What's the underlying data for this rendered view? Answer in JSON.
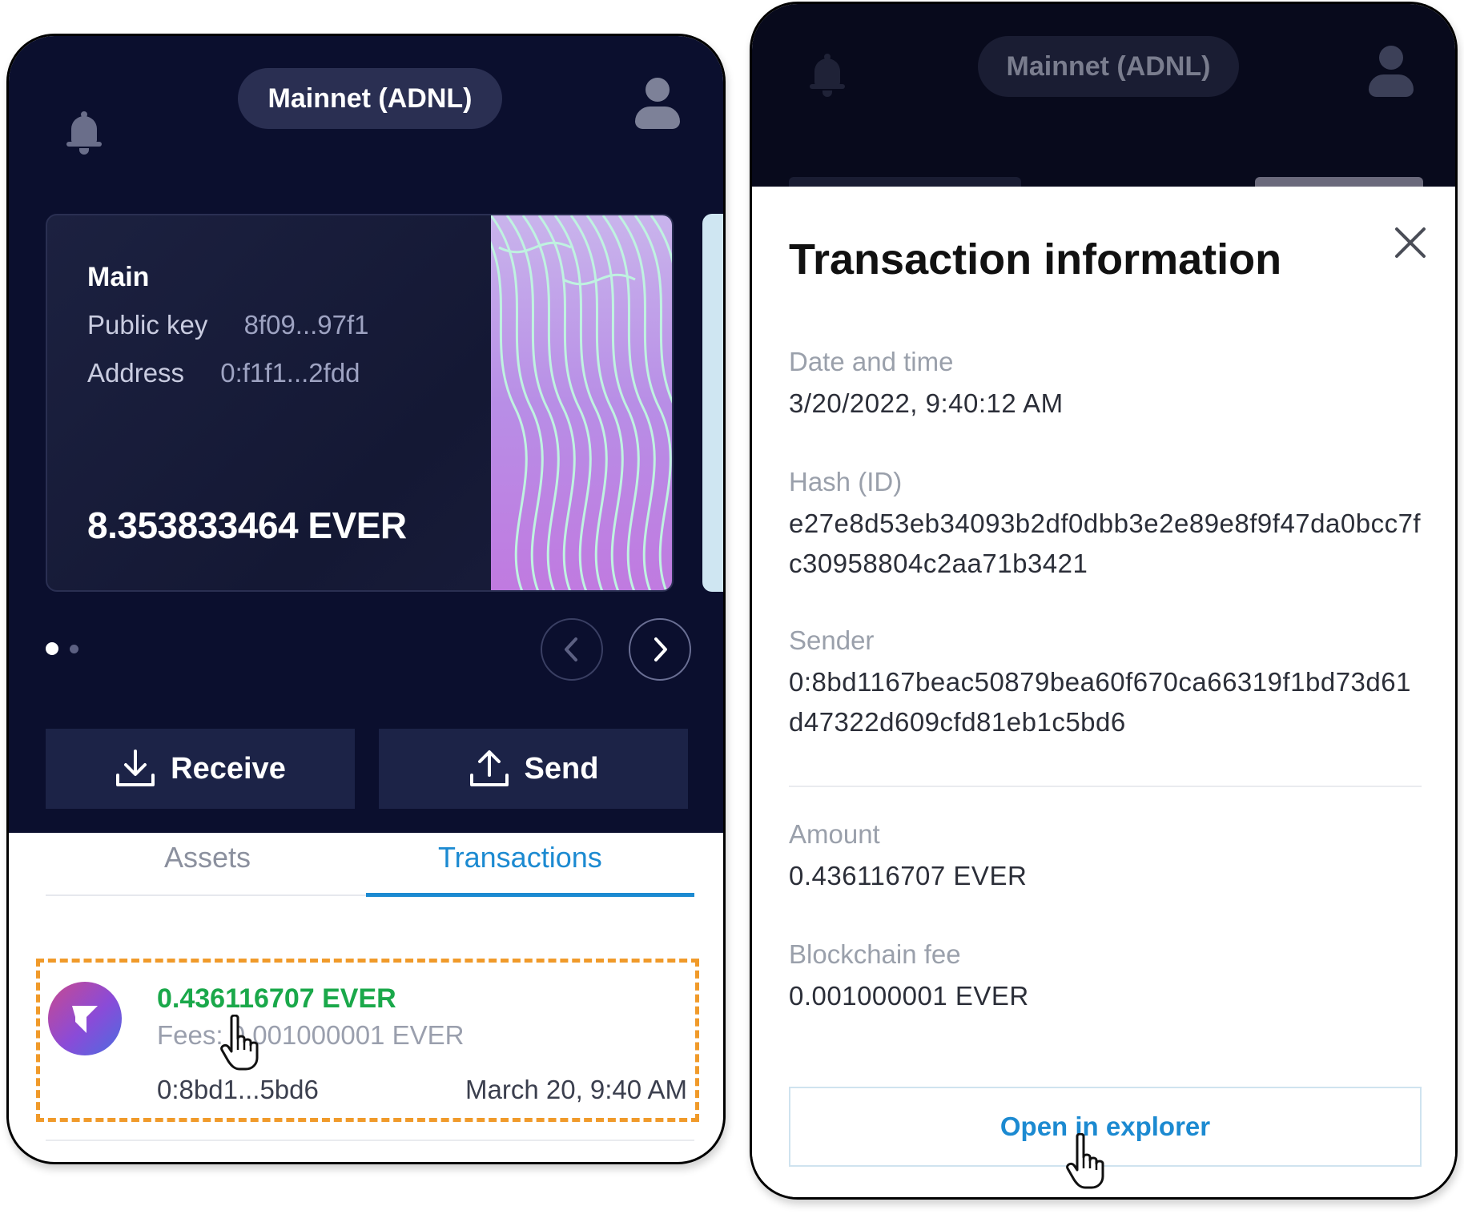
{
  "left": {
    "network": "Mainnet (ADNL)",
    "card": {
      "name": "Main",
      "public_key_label": "Public key",
      "public_key_value": "8f09...97f1",
      "address_label": "Address",
      "address_value": "0:f1f1...2fdd",
      "balance": "8.353833464 EVER"
    },
    "pager": {
      "total_pages": 2,
      "active_page": 1
    },
    "actions": {
      "receive": "Receive",
      "send": "Send"
    },
    "tabs": {
      "assets": "Assets",
      "transactions": "Transactions",
      "active": "Transactions"
    },
    "transaction": {
      "amount": "0.436116707 EVER",
      "fees": "Fees: 0.001000001 EVER",
      "address": "0:8bd1...5bd6",
      "date": "March 20, 9:40 AM"
    }
  },
  "right": {
    "network": "Mainnet (ADNL)",
    "title": "Transaction information",
    "fields": {
      "date_label": "Date and time",
      "date_value": "3/20/2022, 9:40:12 AM",
      "hash_label": "Hash (ID)",
      "hash_value": "e27e8d53eb34093b2df0dbb3e2e89e8f9f47da0bcc7fc30958804c2aa71b3421",
      "sender_label": "Sender",
      "sender_value": "0:8bd1167beac50879bea60f670ca66319f1bd73d61d47322d609cfd81eb1c5bd6",
      "amount_label": "Amount",
      "amount_value": "0.436116707 EVER",
      "fee_label": "Blockchain fee",
      "fee_value": "0.001000001 EVER"
    },
    "explorer_button": "Open in explorer"
  },
  "colors": {
    "dark_bg": "#0b0f2e",
    "accent_blue": "#1c8ad1",
    "positive_green": "#1aa84a",
    "highlight_orange": "#f09a2a"
  }
}
